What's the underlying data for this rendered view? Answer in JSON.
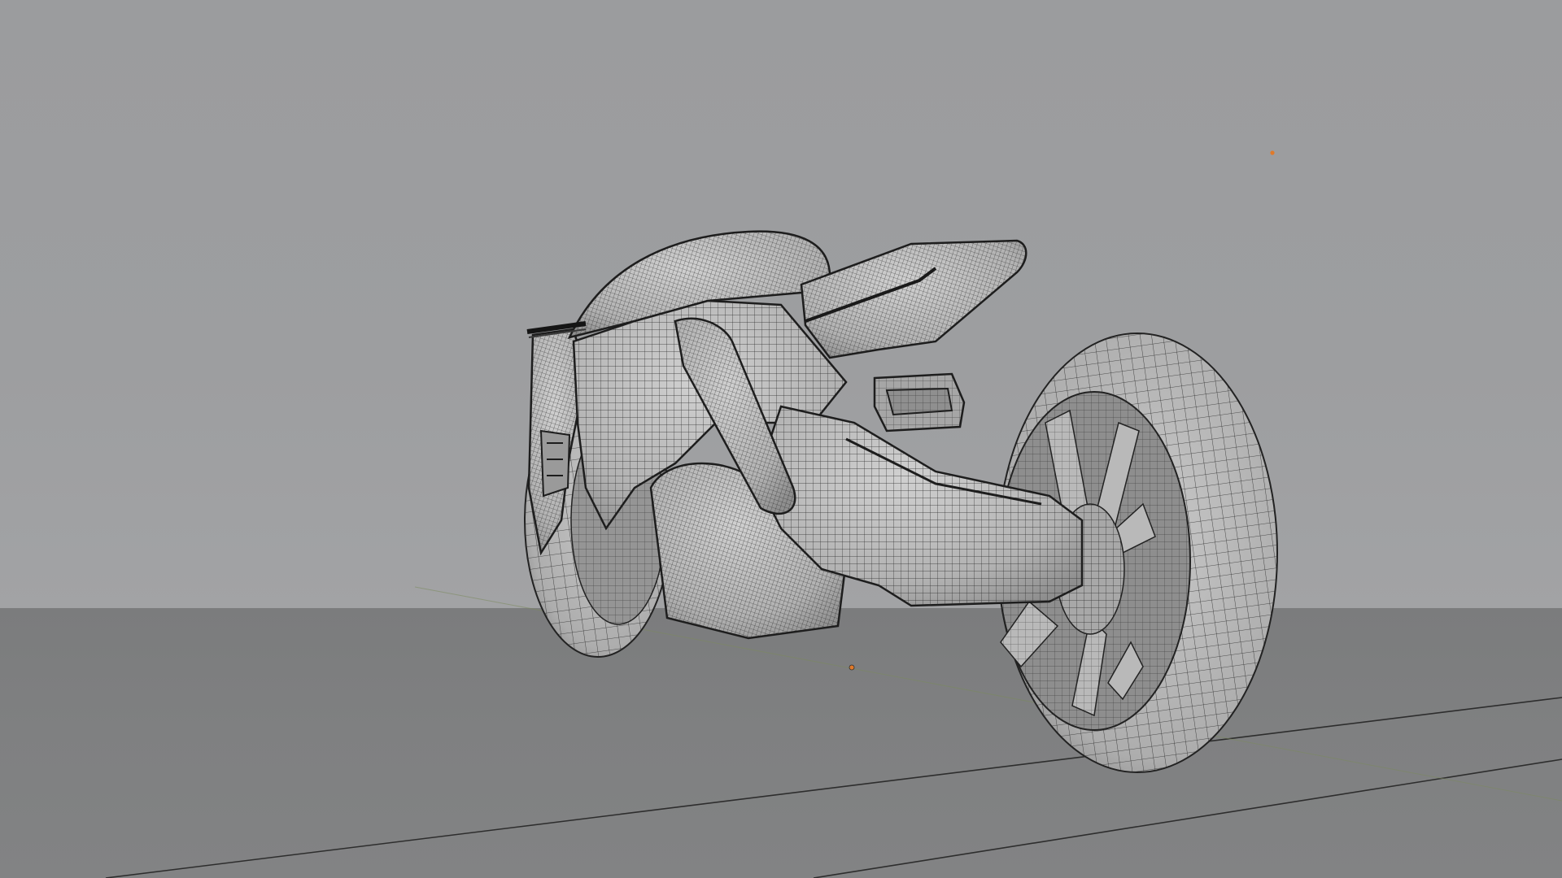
{
  "viewport": {
    "shading_mode": "wireframe-solid",
    "background_color": "#9c9d9f",
    "ground_color": "#7e7f80",
    "wire_color": "#1e1e1e",
    "mesh_fill_color": "#b9b9b9",
    "origin_marker_color": "#e07a2a"
  },
  "scene": {
    "object": "motorcycle-mesh",
    "markers": [
      "light-origin-marker",
      "object-origin-marker"
    ]
  }
}
